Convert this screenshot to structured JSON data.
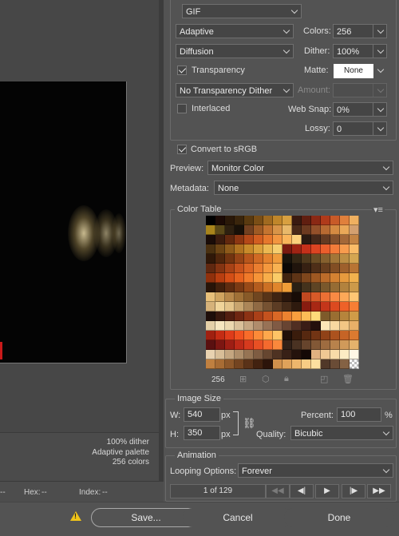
{
  "preview": {
    "info_lines": [
      "100% dither",
      "Adaptive palette",
      "256 colors"
    ],
    "status": {
      "left_label": "--",
      "hex_label": "Hex:",
      "hex_value": "--",
      "index_label": "Index:",
      "index_value": "--"
    }
  },
  "settings": {
    "format": "GIF",
    "reduction": "Adaptive",
    "colors_label": "Colors:",
    "colors_value": "256",
    "dither_algo": "Diffusion",
    "dither_label": "Dither:",
    "dither_value": "100%",
    "transparency_label": "Transparency",
    "transparency_checked": true,
    "matte_label": "Matte:",
    "matte_value": "None",
    "trans_dither": "No Transparency Dither",
    "amount_label": "Amount:",
    "amount_value": "",
    "interlaced_label": "Interlaced",
    "interlaced_checked": false,
    "websnap_label": "Web Snap:",
    "websnap_value": "0%",
    "lossy_label": "Lossy:",
    "lossy_value": "0",
    "convert_srgb_label": "Convert to sRGB",
    "convert_srgb_checked": true,
    "preview_label": "Preview:",
    "preview_value": "Monitor Color",
    "metadata_label": "Metadata:",
    "metadata_value": "None"
  },
  "color_table": {
    "title": "Color Table",
    "count": "256",
    "colors": [
      "#000000",
      "#1c0a05",
      "#2a1808",
      "#3a250c",
      "#5a3a10",
      "#7a4e16",
      "#a06a20",
      "#c0862a",
      "#d8a040",
      "#3a1a10",
      "#601e10",
      "#8a2814",
      "#b03a1a",
      "#c85a28",
      "#e0803c",
      "#f0b060",
      "#a8841c",
      "#5a4818",
      "#2e2010",
      "#181008",
      "#724020",
      "#9e5a24",
      "#c47430",
      "#d89448",
      "#e8b86a",
      "#4a2a18",
      "#6c3a20",
      "#94502a",
      "#b86a32",
      "#d48a42",
      "#eaa858",
      "#d4a070",
      "#1a0c08",
      "#3c1c0e",
      "#62280e",
      "#8c3612",
      "#b44818",
      "#d25e20",
      "#e6782c",
      "#f29640",
      "#fab45a",
      "#fcd07c",
      "#2a1a12",
      "#46281a",
      "#643a22",
      "#84502c",
      "#a46838",
      "#c48444",
      "#4a3010",
      "#6c4414",
      "#8e5a1a",
      "#b07220",
      "#c88a2a",
      "#dca03a",
      "#ecb852",
      "#f6ce70",
      "#7a1a10",
      "#a02414",
      "#c4301a",
      "#dc4422",
      "#ec5e2c",
      "#f47c3a",
      "#f89c4e",
      "#fabc68",
      "#301808",
      "#50260c",
      "#723410",
      "#964416",
      "#b8561c",
      "#d06a24",
      "#e4822e",
      "#f09c3c",
      "#1a140c",
      "#342614",
      "#4e381c",
      "#6a4c24",
      "#86602e",
      "#a27638",
      "#bc8e44",
      "#d4a652",
      "#602810",
      "#843412",
      "#a84216",
      "#c6521c",
      "#dc6624",
      "#ea7e30",
      "#f4983e",
      "#f8b252",
      "#0c0806",
      "#20140c",
      "#362012",
      "#4e2e18",
      "#683e1e",
      "#824e24",
      "#9e602c",
      "#b87434",
      "#90300c",
      "#b83e10",
      "#d44e16",
      "#e6621e",
      "#f07a2a",
      "#f69438",
      "#f8ae4a",
      "#facc68",
      "#402410",
      "#5e3416",
      "#7e461c",
      "#9e5822",
      "#bc6c2a",
      "#d48232",
      "#e69a3e",
      "#f2b24e",
      "#281408",
      "#42200c",
      "#5e2c10",
      "#7a3a14",
      "#984a18",
      "#b45c1e",
      "#cc7024",
      "#e0862c",
      "#f09e38",
      "#2a2014",
      "#44321c",
      "#5e4424",
      "#7a582c",
      "#966c34",
      "#b2823e",
      "#cc9a4a",
      "#e8c07a",
      "#d0a460",
      "#b8884a",
      "#a07036",
      "#885a28",
      "#704620",
      "#583418",
      "#402412",
      "#2a160c",
      "#180c06",
      "#c04820",
      "#d85a28",
      "#ec7034",
      "#f88a44",
      "#fca858",
      "#fec674",
      "#d6b27a",
      "#f0d49a",
      "#e4c48a",
      "#c8a46e",
      "#ac8658",
      "#906a44",
      "#765232",
      "#5c3c24",
      "#442a18",
      "#2e1a0e",
      "#881c10",
      "#a82814",
      "#c4361a",
      "#dc4a20",
      "#ee6228",
      "#f87e34",
      "#1e0e0a",
      "#38180e",
      "#521e10",
      "#6e2612",
      "#8c3214",
      "#aa4018",
      "#c4521e",
      "#da6826",
      "#ec8230",
      "#f89e3e",
      "#fcbc56",
      "#feda7a",
      "#7e5a2a",
      "#9a6e32",
      "#b6843c",
      "#d09c48",
      "#e4d0a8",
      "#f6e6c0",
      "#ecd8b0",
      "#dac09a",
      "#c6a682",
      "#b08c6c",
      "#987256",
      "#805a44",
      "#684432",
      "#502e22",
      "#3a1c16",
      "#24100c",
      "#fce6b8",
      "#f8d8a0",
      "#f2c684",
      "#e8b068",
      "#a02010",
      "#c42c14",
      "#de3c1a",
      "#f05220",
      "#f86c2a",
      "#fc8a38",
      "#fea84c",
      "#fec466",
      "#201008",
      "#3a1c0c",
      "#562810",
      "#723414",
      "#904218",
      "#ac521e",
      "#c66426",
      "#dc7a30",
      "#5a1010",
      "#7c1612",
      "#9e1e14",
      "#be2a18",
      "#d63a1e",
      "#e85024",
      "#f46a2e",
      "#fa883c",
      "#302018",
      "#4a3222",
      "#66442c",
      "#825836",
      "#9e6c40",
      "#b8824c",
      "#d09a5a",
      "#e4b26c",
      "#e8d2b0",
      "#d8be98",
      "#c4a680",
      "#ae8e6a",
      "#967454",
      "#7e5c42",
      "#664630",
      "#4e3222",
      "#382016",
      "#24120c",
      "#140806",
      "#e0b080",
      "#f0c894",
      "#f8dca8",
      "#fcecc4",
      "#fff8e6",
      "#c08040",
      "#a86c34",
      "#8e582a",
      "#744420",
      "#5a3218",
      "#422210",
      "#2c140a",
      "#d0904c",
      "#e0a25a",
      "#eeb66c",
      "#f8cc84",
      "#fce0a0",
      "#503828",
      "#6a4c36",
      "#846244",
      "#9e7852"
    ]
  },
  "image_size": {
    "title": "Image Size",
    "w_label": "W:",
    "w_value": "540",
    "h_label": "H:",
    "h_value": "350",
    "unit": "px",
    "percent_label": "Percent:",
    "percent_value": "100",
    "percent_unit": "%",
    "quality_label": "Quality:",
    "quality_value": "Bicubic"
  },
  "animation": {
    "title": "Animation",
    "looping_label": "Looping Options:",
    "looping_value": "Forever",
    "frame_text": "1 of 129"
  },
  "footer": {
    "save_label": "Save...",
    "cancel_label": "Cancel",
    "done_label": "Done"
  }
}
